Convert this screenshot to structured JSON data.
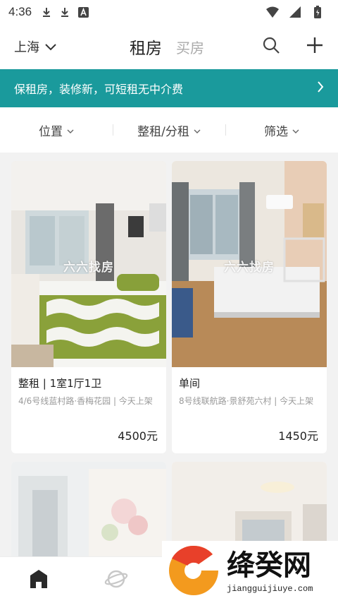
{
  "status_bar": {
    "time": "4:36"
  },
  "header": {
    "city": "上海",
    "tab_rent": "租房",
    "tab_buy": "买房"
  },
  "banner": {
    "text": "保租房，装修新，可短租无中介费"
  },
  "filters": [
    {
      "label": "位置"
    },
    {
      "label": "整租/分租"
    },
    {
      "label": "筛选"
    }
  ],
  "listings": [
    {
      "title": "整租 | 1室1厅1卫",
      "subtitle": "4/6号线蓝村路·香梅花园 | 今天上架",
      "price": "4500元",
      "watermark": "六六找房"
    },
    {
      "title": "单间",
      "subtitle": "8号线联航路·景舒苑六村 | 今天上架",
      "price": "1450元",
      "watermark": "六六找房"
    }
  ],
  "logo": {
    "name": "绛癸网",
    "domain": "jiangguijiuye.com"
  },
  "colors": {
    "accent": "#1a9a9c"
  },
  "icons": [
    "download-icon",
    "download-icon",
    "font-icon",
    "wifi-icon",
    "signal-icon",
    "battery-icon",
    "chevron-down-icon",
    "search-icon",
    "plus-icon",
    "chevron-right-icon",
    "home-icon",
    "planet-icon"
  ]
}
